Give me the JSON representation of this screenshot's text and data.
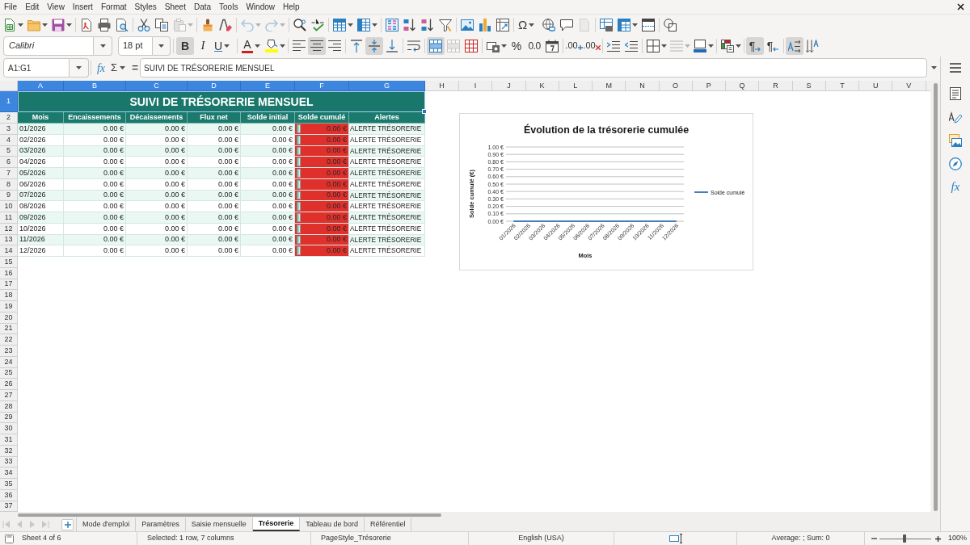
{
  "menu_bar": [
    "File",
    "Edit",
    "View",
    "Insert",
    "Format",
    "Styles",
    "Sheet",
    "Data",
    "Tools",
    "Window",
    "Help"
  ],
  "standard_toolbar": [
    [
      {
        "kind": "new",
        "dropdown": true,
        "disabled": false
      },
      {
        "kind": "open",
        "dropdown": true,
        "disabled": false
      },
      {
        "kind": "save",
        "dropdown": true,
        "disabled": false
      }
    ],
    [
      {
        "kind": "export_pdf",
        "dropdown": false,
        "disabled": false
      },
      {
        "kind": "print",
        "dropdown": false,
        "disabled": false
      },
      {
        "kind": "print_preview",
        "dropdown": false,
        "disabled": false
      }
    ],
    [
      {
        "kind": "cut",
        "dropdown": false,
        "disabled": false
      },
      {
        "kind": "copy",
        "dropdown": false,
        "disabled": false
      },
      {
        "kind": "paste",
        "dropdown": true,
        "disabled": true
      }
    ],
    [
      {
        "kind": "clone_formatting",
        "dropdown": false,
        "disabled": false
      },
      {
        "kind": "clear_formatting",
        "dropdown": false,
        "disabled": false
      }
    ],
    [
      {
        "kind": "undo",
        "dropdown": true,
        "disabled": true
      },
      {
        "kind": "redo",
        "dropdown": true,
        "disabled": true
      }
    ],
    [
      {
        "kind": "find_replace",
        "dropdown": false,
        "disabled": false
      },
      {
        "kind": "spelling",
        "dropdown": false,
        "disabled": false
      }
    ],
    [
      {
        "kind": "rows",
        "dropdown": true,
        "disabled": false
      },
      {
        "kind": "columns",
        "dropdown": true,
        "disabled": false
      }
    ],
    [
      {
        "kind": "sort",
        "dropdown": false,
        "disabled": false
      },
      {
        "kind": "sort_ascending",
        "dropdown": false,
        "disabled": false
      },
      {
        "kind": "sort_descending",
        "dropdown": false,
        "disabled": false
      },
      {
        "kind": "autofilter",
        "dropdown": false,
        "disabled": false
      }
    ],
    [
      {
        "kind": "image",
        "dropdown": false,
        "disabled": false
      },
      {
        "kind": "chart",
        "dropdown": false,
        "disabled": false
      },
      {
        "kind": "pivot_table",
        "dropdown": false,
        "disabled": false
      }
    ],
    [
      {
        "kind": "special_character",
        "label": "Ω",
        "dropdown": true,
        "disabled": false
      },
      {
        "kind": "hyperlink",
        "dropdown": false,
        "disabled": false
      },
      {
        "kind": "comment",
        "dropdown": false,
        "disabled": false
      },
      {
        "kind": "header_footer",
        "dropdown": false,
        "disabled": true
      }
    ],
    [
      {
        "kind": "print_area",
        "dropdown": false,
        "disabled": false
      },
      {
        "kind": "freeze",
        "dropdown": true,
        "disabled": false
      },
      {
        "kind": "split_window",
        "dropdown": false,
        "disabled": false
      }
    ],
    [
      {
        "kind": "shapes",
        "dropdown": false,
        "disabled": false
      }
    ]
  ],
  "formatting_toolbar": {
    "font_name": "Calibri",
    "font_size": "18 pt",
    "groups": [
      [
        {
          "kind": "bold",
          "label": "B",
          "dropdown": false,
          "on": true,
          "disabled": false
        },
        {
          "kind": "italic",
          "label": "I",
          "dropdown": false,
          "on": false,
          "disabled": false
        },
        {
          "kind": "underline",
          "label": "U",
          "dropdown": true,
          "on": false,
          "disabled": false
        }
      ],
      [
        {
          "kind": "font_color",
          "label": "A",
          "dropdown": true,
          "on": false,
          "disabled": false
        },
        {
          "kind": "highlight",
          "dropdown": true,
          "on": false,
          "disabled": false
        }
      ],
      [
        {
          "kind": "align_left",
          "dropdown": false,
          "on": false,
          "disabled": false
        },
        {
          "kind": "align_center",
          "dropdown": false,
          "on": true,
          "disabled": false
        },
        {
          "kind": "align_right",
          "dropdown": false,
          "on": false,
          "disabled": false
        }
      ],
      [
        {
          "kind": "align_top",
          "dropdown": false,
          "on": false,
          "disabled": false
        },
        {
          "kind": "align_middle",
          "dropdown": false,
          "on": true,
          "disabled": false
        },
        {
          "kind": "align_bottom",
          "dropdown": false,
          "on": false,
          "disabled": false
        }
      ],
      [
        {
          "kind": "wrap_text",
          "dropdown": false,
          "on": false,
          "disabled": false
        }
      ],
      [
        {
          "kind": "merge_center",
          "dropdown": false,
          "on": true,
          "disabled": false
        },
        {
          "kind": "merge",
          "dropdown": false,
          "on": false,
          "disabled": true
        },
        {
          "kind": "unmerge",
          "dropdown": false,
          "on": false,
          "disabled": false
        }
      ],
      [
        {
          "kind": "currency",
          "dropdown": true,
          "on": false,
          "disabled": false
        },
        {
          "kind": "percent",
          "label": "%",
          "dropdown": false,
          "on": false,
          "disabled": false
        },
        {
          "kind": "number",
          "label": "0.0",
          "dropdown": false,
          "on": false,
          "disabled": false
        },
        {
          "kind": "date",
          "dropdown": false,
          "on": false,
          "disabled": false
        }
      ],
      [
        {
          "kind": "add_decimal",
          "label": ".00",
          "dropdown": false,
          "on": false,
          "disabled": false
        },
        {
          "kind": "delete_decimal",
          "label": ".00",
          "dropdown": false,
          "on": false,
          "disabled": false
        }
      ],
      [
        {
          "kind": "increase_indent",
          "dropdown": false,
          "on": false,
          "disabled": false
        },
        {
          "kind": "decrease_indent",
          "dropdown": false,
          "on": false,
          "disabled": false
        }
      ],
      [
        {
          "kind": "borders",
          "dropdown": true,
          "on": false,
          "disabled": false
        },
        {
          "kind": "border_style",
          "dropdown": true,
          "on": false,
          "disabled": true
        },
        {
          "kind": "border_color",
          "dropdown": true,
          "on": false,
          "disabled": false
        }
      ],
      [
        {
          "kind": "conditional",
          "dropdown": true,
          "on": false,
          "disabled": false
        }
      ],
      [
        {
          "kind": "paragraph_ltr",
          "label": "¶",
          "dropdown": false,
          "on": true,
          "disabled": false
        },
        {
          "kind": "paragraph_rtl",
          "label": "¶",
          "dropdown": false,
          "on": false,
          "disabled": false
        }
      ],
      [
        {
          "kind": "text_ltr",
          "dropdown": false,
          "on": true,
          "disabled": false
        },
        {
          "kind": "text_ttb",
          "dropdown": false,
          "on": false,
          "disabled": false
        }
      ]
    ]
  },
  "formula_bar": {
    "name_box": "A1:G1",
    "function_wizard": "fx",
    "sum": "Σ",
    "equals": "=",
    "content": "SUIVI DE TRÉSORERIE MENSUEL"
  },
  "sheet": {
    "columns": [
      {
        "label": "A",
        "selected": true
      },
      {
        "label": "B",
        "selected": true
      },
      {
        "label": "C",
        "selected": true
      },
      {
        "label": "D",
        "selected": true
      },
      {
        "label": "E",
        "selected": true
      },
      {
        "label": "F",
        "selected": true
      },
      {
        "label": "G",
        "selected": true
      },
      {
        "label": "H",
        "selected": false
      },
      {
        "label": "I",
        "selected": false
      },
      {
        "label": "J",
        "selected": false
      },
      {
        "label": "K",
        "selected": false
      },
      {
        "label": "L",
        "selected": false
      },
      {
        "label": "M",
        "selected": false
      },
      {
        "label": "N",
        "selected": false
      },
      {
        "label": "O",
        "selected": false
      },
      {
        "label": "P",
        "selected": false
      },
      {
        "label": "Q",
        "selected": false
      },
      {
        "label": "R",
        "selected": false
      },
      {
        "label": "S",
        "selected": false
      },
      {
        "label": "T",
        "selected": false
      },
      {
        "label": "U",
        "selected": false
      },
      {
        "label": "V",
        "selected": false
      }
    ],
    "rows": [
      {
        "label": "1",
        "selected": true
      },
      {
        "label": "2",
        "selected": false
      },
      {
        "label": "3",
        "selected": false
      },
      {
        "label": "4",
        "selected": false
      },
      {
        "label": "5",
        "selected": false
      },
      {
        "label": "6",
        "selected": false
      },
      {
        "label": "7",
        "selected": false
      },
      {
        "label": "8",
        "selected": false
      },
      {
        "label": "9",
        "selected": false
      },
      {
        "label": "10",
        "selected": false
      },
      {
        "label": "11",
        "selected": false
      },
      {
        "label": "12",
        "selected": false
      },
      {
        "label": "13",
        "selected": false
      },
      {
        "label": "14",
        "selected": false
      },
      {
        "label": "15",
        "selected": false
      },
      {
        "label": "16",
        "selected": false
      },
      {
        "label": "17",
        "selected": false
      },
      {
        "label": "18",
        "selected": false
      },
      {
        "label": "19",
        "selected": false
      },
      {
        "label": "20",
        "selected": false
      },
      {
        "label": "21",
        "selected": false
      },
      {
        "label": "22",
        "selected": false
      },
      {
        "label": "23",
        "selected": false
      },
      {
        "label": "24",
        "selected": false
      },
      {
        "label": "25",
        "selected": false
      },
      {
        "label": "26",
        "selected": false
      },
      {
        "label": "27",
        "selected": false
      },
      {
        "label": "28",
        "selected": false
      },
      {
        "label": "29",
        "selected": false
      },
      {
        "label": "30",
        "selected": false
      },
      {
        "label": "31",
        "selected": false
      },
      {
        "label": "32",
        "selected": false
      },
      {
        "label": "33",
        "selected": false
      },
      {
        "label": "34",
        "selected": false
      },
      {
        "label": "35",
        "selected": false
      },
      {
        "label": "36",
        "selected": false
      },
      {
        "label": "37",
        "selected": false
      }
    ]
  },
  "table": {
    "title": "SUIVI DE TRÉSORERIE MENSUEL",
    "headers": [
      "Mois",
      "Encaissements",
      "Décaissements",
      "Flux net",
      "Solde initial",
      "Solde cumulé",
      "Alertes"
    ],
    "rows": [
      {
        "cells": [
          "01/2026",
          "0.00 €",
          "0.00 €",
          "0.00 €",
          "0.00 €",
          "0.00 €",
          "ALERTE TRÉSORERIE"
        ],
        "level": 0.08,
        "alert": true
      },
      {
        "cells": [
          "02/2026",
          "0.00 €",
          "0.00 €",
          "0.00 €",
          "0.00 €",
          "0.00 €",
          "ALERTE TRÉSORERIE"
        ],
        "level": 0.08,
        "alert": true
      },
      {
        "cells": [
          "03/2026",
          "0.00 €",
          "0.00 €",
          "0.00 €",
          "0.00 €",
          "0.00 €",
          "ALERTE TRÉSORERIE"
        ],
        "level": 0.08,
        "alert": true
      },
      {
        "cells": [
          "04/2026",
          "0.00 €",
          "0.00 €",
          "0.00 €",
          "0.00 €",
          "0.00 €",
          "ALERTE TRÉSORERIE"
        ],
        "level": 0.08,
        "alert": true
      },
      {
        "cells": [
          "05/2026",
          "0.00 €",
          "0.00 €",
          "0.00 €",
          "0.00 €",
          "0.00 €",
          "ALERTE TRÉSORERIE"
        ],
        "level": 0.08,
        "alert": true
      },
      {
        "cells": [
          "06/2026",
          "0.00 €",
          "0.00 €",
          "0.00 €",
          "0.00 €",
          "0.00 €",
          "ALERTE TRÉSORERIE"
        ],
        "level": 0.08,
        "alert": true
      },
      {
        "cells": [
          "07/2026",
          "0.00 €",
          "0.00 €",
          "0.00 €",
          "0.00 €",
          "0.00 €",
          "ALERTE TRÉSORERIE"
        ],
        "level": 0.08,
        "alert": true
      },
      {
        "cells": [
          "08/2026",
          "0.00 €",
          "0.00 €",
          "0.00 €",
          "0.00 €",
          "0.00 €",
          "ALERTE TRÉSORERIE"
        ],
        "level": 0.08,
        "alert": true
      },
      {
        "cells": [
          "09/2026",
          "0.00 €",
          "0.00 €",
          "0.00 €",
          "0.00 €",
          "0.00 €",
          "ALERTE TRÉSORERIE"
        ],
        "level": 0.08,
        "alert": true
      },
      {
        "cells": [
          "10/2026",
          "0.00 €",
          "0.00 €",
          "0.00 €",
          "0.00 €",
          "0.00 €",
          "ALERTE TRÉSORERIE"
        ],
        "level": 0.08,
        "alert": true
      },
      {
        "cells": [
          "11/2026",
          "0.00 €",
          "0.00 €",
          "0.00 €",
          "0.00 €",
          "0.00 €",
          "ALERTE TRÉSORERIE"
        ],
        "level": 0.08,
        "alert": true
      },
      {
        "cells": [
          "12/2026",
          "0.00 €",
          "0.00 €",
          "0.00 €",
          "0.00 €",
          "0.00 €",
          "ALERTE TRÉSORERIE"
        ],
        "level": 0.08,
        "alert": true
      }
    ]
  },
  "chart": {
    "chart_data": {
      "type": "line",
      "title": "Évolution de la trésorerie cumulée",
      "xlabel": "Mois",
      "ylabel": "Solde cumulé (€)",
      "categories": [
        "01/2026",
        "02/2026",
        "03/2026",
        "04/2026",
        "05/2026",
        "06/2026",
        "07/2026",
        "08/2026",
        "09/2026",
        "10/2026",
        "11/2026",
        "12/2026"
      ],
      "series": [
        {
          "name": "Solde cumulé",
          "color": "#4a7ebb",
          "values": [
            0,
            0,
            0,
            0,
            0,
            0,
            0,
            0,
            0,
            0,
            0,
            0
          ]
        }
      ],
      "ylim": [
        0,
        1
      ],
      "yticks": [
        {
          "value": 0,
          "label": "0.00 €"
        },
        {
          "value": 0.1,
          "label": "0.10 €"
        },
        {
          "value": 0.2,
          "label": "0.20 €"
        },
        {
          "value": 0.3,
          "label": "0.30 €"
        },
        {
          "value": 0.4,
          "label": "0.40 €"
        },
        {
          "value": 0.5,
          "label": "0.50 €"
        },
        {
          "value": 0.6,
          "label": "0.60 €"
        },
        {
          "value": 0.7,
          "label": "0.70 €"
        },
        {
          "value": 0.8,
          "label": "0.80 €"
        },
        {
          "value": 0.9,
          "label": "0.90 €"
        },
        {
          "value": 1,
          "label": "1.00 €"
        }
      ],
      "grid": true
    }
  },
  "sheet_navigation": [
    {
      "kind": "first",
      "disabled": true
    },
    {
      "kind": "previous",
      "disabled": true
    },
    {
      "kind": "next",
      "disabled": true
    },
    {
      "kind": "last",
      "disabled": true
    }
  ],
  "sheet_tabs": [
    {
      "label": "Mode d'emploi",
      "selected": false
    },
    {
      "label": "Paramètres",
      "selected": false
    },
    {
      "label": "Saisie mensuelle",
      "selected": false
    },
    {
      "label": "Trésorerie",
      "selected": true
    },
    {
      "label": "Tableau de bord",
      "selected": false
    },
    {
      "label": "Référentiel",
      "selected": false
    }
  ],
  "sidebar": [
    {
      "kind": "menu"
    },
    {
      "kind": "properties"
    },
    {
      "kind": "styles"
    },
    {
      "kind": "gallery"
    },
    {
      "kind": "navigator"
    },
    {
      "kind": "functions",
      "label": "fx"
    }
  ],
  "status_bar": {
    "sheet": "Sheet 4 of 6",
    "selection": "Selected: 1 row, 7 columns",
    "page_style": "PageStyle_Trésorerie",
    "language": "English (USA)",
    "summary": "Average: ; Sum: 0",
    "zoom_slider": {
      "level": 0.48
    },
    "zoom_percent": "100%"
  }
}
